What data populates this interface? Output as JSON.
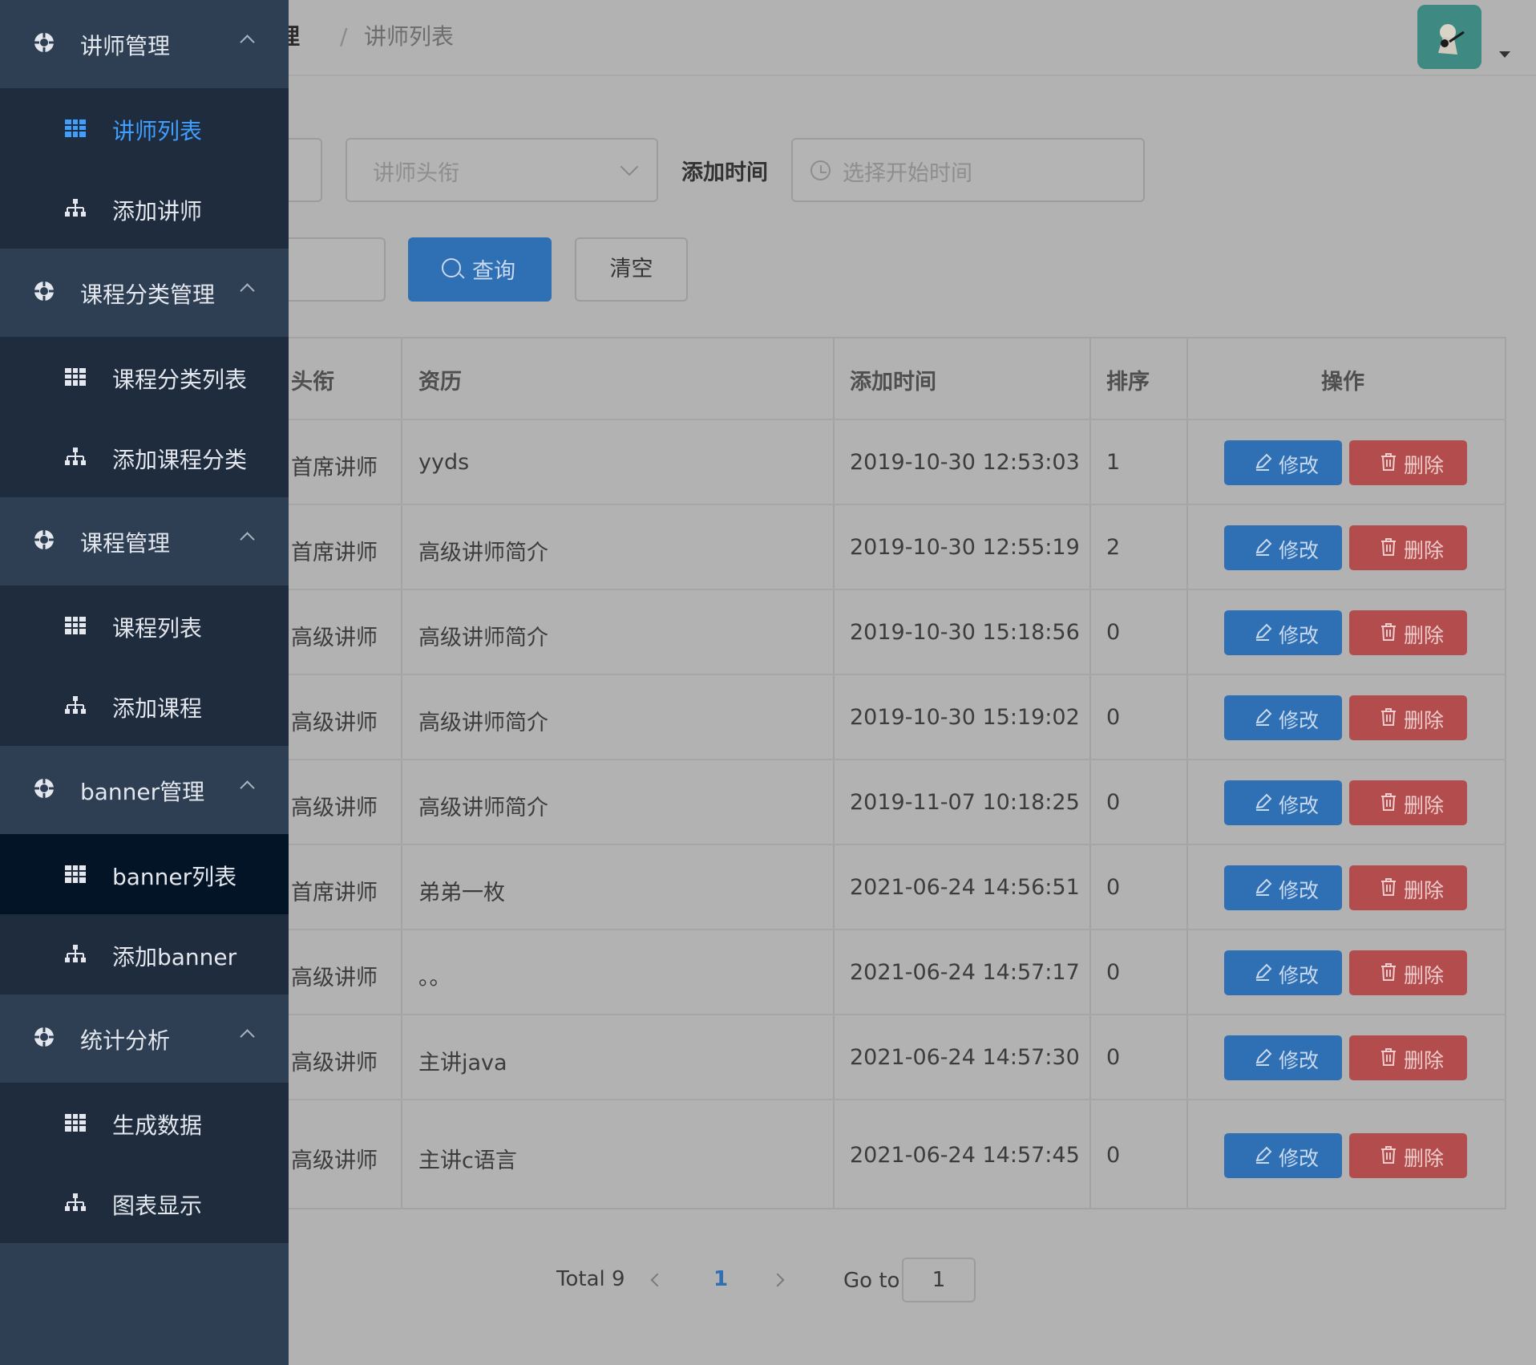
{
  "breadcrumb": {
    "parent": "管理",
    "separator": "/",
    "current": "讲师列表"
  },
  "filters": {
    "title_placeholder": "讲师头衔",
    "add_time_label": "添加时间",
    "start_time_placeholder": "选择开始时间",
    "query_label": "查询",
    "clear_label": "清空"
  },
  "table": {
    "headers": [
      "头衔",
      "资历",
      "添加时间",
      "排序",
      "操作"
    ],
    "rows": [
      {
        "level": "首席讲师",
        "intro": "yyds",
        "time": "2019-10-30 12:53:03",
        "sort": "1"
      },
      {
        "level": "首席讲师",
        "intro": "高级讲师简介",
        "time": "2019-10-30 12:55:19",
        "sort": "2"
      },
      {
        "level": "高级讲师",
        "intro": "高级讲师简介",
        "time": "2019-10-30 15:18:56",
        "sort": "0"
      },
      {
        "level": "高级讲师",
        "intro": "高级讲师简介",
        "time": "2019-10-30 15:19:02",
        "sort": "0"
      },
      {
        "level": "高级讲师",
        "intro": "高级讲师简介",
        "time": "2019-11-07 10:18:25",
        "sort": "0"
      },
      {
        "level": "首席讲师",
        "intro": "弟弟一枚",
        "time": "2021-06-24 14:56:51",
        "sort": "0"
      },
      {
        "level": "高级讲师",
        "intro": "。。",
        "time": "2021-06-24 14:57:17",
        "sort": "0"
      },
      {
        "level": "高级讲师",
        "intro": "主讲java",
        "time": "2021-06-24 14:57:30",
        "sort": "0"
      },
      {
        "level": "高级讲师",
        "intro": "主讲c语言",
        "time": "2021-06-24 14:57:45",
        "sort": "0"
      }
    ],
    "edit_label": "修改",
    "delete_label": "删除"
  },
  "pagination": {
    "total": "Total 9",
    "current": "1",
    "goto_label": "Go to",
    "goto_value": "1"
  },
  "sidebar": {
    "groups": [
      {
        "label": "讲师管理",
        "items": [
          {
            "label": "讲师列表",
            "icon": "table-icon"
          },
          {
            "label": "添加讲师",
            "icon": "tree-icon"
          }
        ]
      },
      {
        "label": "课程分类管理",
        "items": [
          {
            "label": "课程分类列表",
            "icon": "table-icon"
          },
          {
            "label": "添加课程分类",
            "icon": "tree-icon"
          }
        ]
      },
      {
        "label": "课程管理",
        "items": [
          {
            "label": "课程列表",
            "icon": "table-icon"
          },
          {
            "label": "添加课程",
            "icon": "tree-icon"
          }
        ]
      },
      {
        "label": "banner管理",
        "items": [
          {
            "label": "banner列表",
            "icon": "table-icon"
          },
          {
            "label": "添加banner",
            "icon": "tree-icon"
          }
        ]
      },
      {
        "label": "统计分析",
        "items": [
          {
            "label": "生成数据",
            "icon": "table-icon"
          },
          {
            "label": "图表显示",
            "icon": "tree-icon"
          }
        ]
      }
    ]
  },
  "colors": {
    "sidebar_bg": "#2e3f54",
    "submenu_bg": "#1e2c3d",
    "active_text": "#409eff",
    "primary": "#2f6fb3",
    "danger": "#b34d4d"
  }
}
